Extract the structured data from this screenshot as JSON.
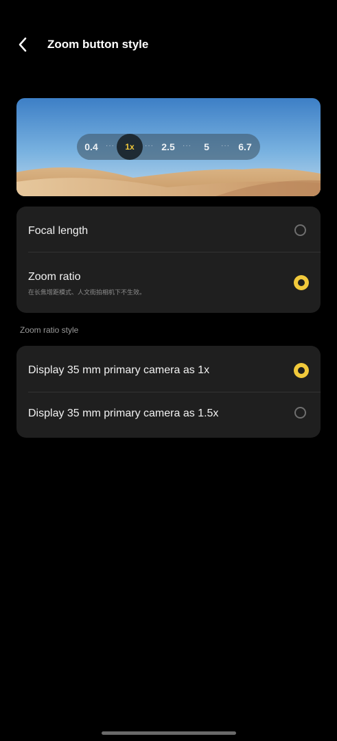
{
  "header": {
    "title": "Zoom button style"
  },
  "preview": {
    "zoom_values": [
      "0.4",
      "1x",
      "2.5",
      "5",
      "6.7"
    ],
    "dots": "···"
  },
  "zoom_mode": {
    "options": [
      {
        "label": "Focal length",
        "selected": false
      },
      {
        "label": "Zoom ratio",
        "subtitle": "在长焦增距模式、人文街拍相机下不生效。",
        "selected": true
      }
    ]
  },
  "zoom_ratio_style": {
    "label": "Zoom ratio style",
    "options": [
      {
        "label": "Display 35 mm primary camera as 1x",
        "selected": true
      },
      {
        "label": "Display 35 mm primary camera as 1.5x",
        "selected": false
      }
    ]
  },
  "colors": {
    "accent": "#f1c93b",
    "card": "#1f1f1f",
    "background": "#000000"
  }
}
